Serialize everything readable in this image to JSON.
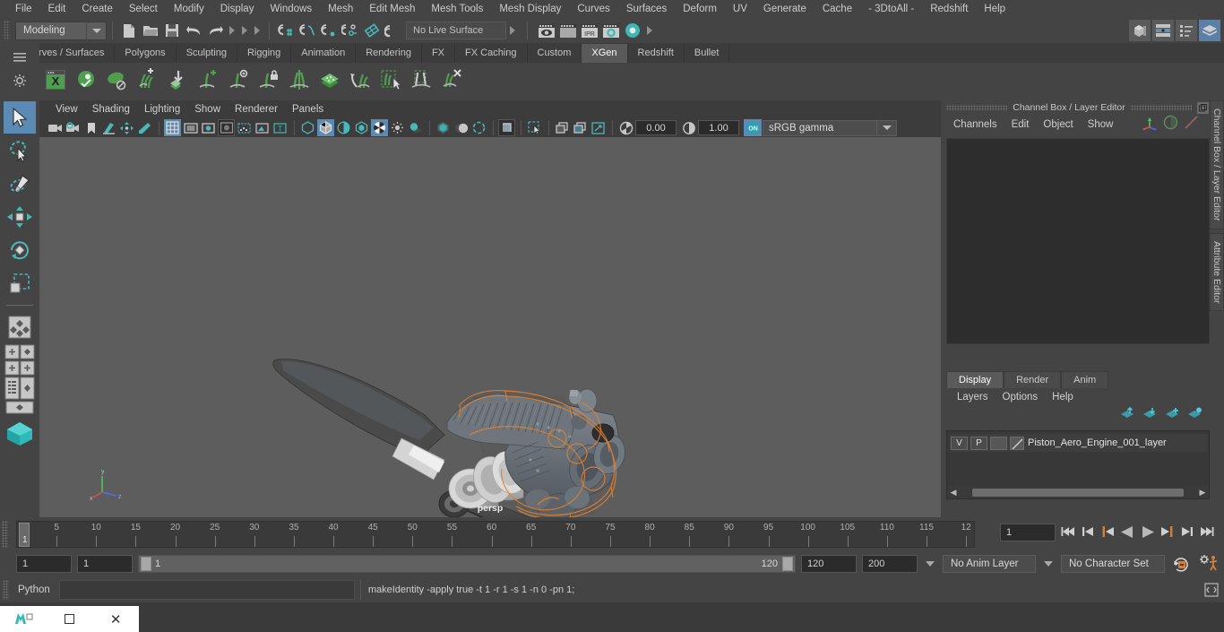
{
  "app": {
    "menubar": [
      "File",
      "Edit",
      "Create",
      "Select",
      "Modify",
      "Display",
      "Windows",
      "Mesh",
      "Edit Mesh",
      "Mesh Tools",
      "Mesh Display",
      "Curves",
      "Surfaces",
      "Deform",
      "UV",
      "Generate",
      "Cache",
      "- 3DtoAll -",
      "Redshift",
      "Help"
    ]
  },
  "status_line": {
    "menu_set": "Modeling",
    "live_surface": "No Live Surface",
    "icons": [
      "new-scene-icon",
      "open-scene-icon",
      "save-scene-icon",
      "undo-icon",
      "redo-icon",
      "select-by-hierarchy-icon",
      "select-by-object-icon",
      "select-by-component-icon",
      "snap-to-grid-icon",
      "snap-to-curve-icon",
      "snap-to-point-icon",
      "snap-to-projected-center-icon",
      "snap-to-view-plane-icon",
      "make-live-icon",
      "render-view-icon",
      "render-current-frame-icon",
      "ipr-render-icon",
      "render-settings-icon",
      "hypershade-icon"
    ],
    "right_icons": [
      "show-hide-modeling-toolkit-icon",
      "show-hide-attribute-editor-icon",
      "show-hide-tool-settings-icon",
      "show-hide-channel-box-icon"
    ]
  },
  "shelf": {
    "tabs": [
      "Curves / Surfaces",
      "Polygons",
      "Sculpting",
      "Rigging",
      "Animation",
      "Rendering",
      "FX",
      "FX Caching",
      "Custom",
      "XGen",
      "Redshift",
      "Bullet"
    ],
    "active_tab": "XGen",
    "icons": [
      "xgen-editor-icon",
      "xgen-preview-icon",
      "xgen-disable-preview-icon",
      "xgen-add-description-icon",
      "xgen-import-collection-icon",
      "xgen-add-guide-icon",
      "xgen-select-guide-icon",
      "xgen-lock-guide-icon",
      "xgen-mirror-guide-icon",
      "xgen-add-region-map-icon",
      "xgen-convert-to-interactive-icon",
      "xgen-select-primitives-icon",
      "xgen-clump-modifier-icon",
      "xgen-delete-guide-icon"
    ]
  },
  "toolbox": {
    "items": [
      "select-tool",
      "lasso-select-tool",
      "paint-select-tool",
      "move-tool",
      "rotate-tool",
      "scale-tool",
      "last-tool-used",
      "snap-layout-1",
      "snap-layout-2",
      "snap-layout-3",
      "snap-layout-4",
      "outliner-layout",
      "persp-layout",
      "single-perspective-view",
      "maya-logo"
    ],
    "selected": "select-tool"
  },
  "viewport": {
    "menus": [
      "View",
      "Shading",
      "Lighting",
      "Show",
      "Renderer",
      "Panels"
    ],
    "camera_label": "persp",
    "exposure": "0.00",
    "gamma": "1.00",
    "color_space": "sRGB gamma",
    "toolbar_icons": [
      "select-camera-icon",
      "camera-attributes-icon",
      "bookmark-icon",
      "image-plane-icon",
      "two-d-pan-zoom-icon",
      "grease-pencil-icon",
      "grid-toggle-icon",
      "film-gate-icon",
      "resolution-gate-icon",
      "gate-mask-icon",
      "film-origin-icon",
      "exposure-icon",
      "xray-icon",
      "wireframe-shaded-icon",
      "smooth-shaded-icon",
      "shaded-wireframe-icon",
      "textured-icon",
      "lighting-icon",
      "shadows-icon",
      "screen-space-ao-icon",
      "motion-blur-icon",
      "multisample-icon",
      "isolate-select-icon",
      "xray-joints-icon",
      "xray-active-components-icon",
      "exposure-gamma-icon",
      "view-transform-on-icon"
    ],
    "axis_gizmo": "axis-gizmo-xyz"
  },
  "channel_box": {
    "title": "Channel Box / Layer Editor",
    "menus": [
      "Channels",
      "Edit",
      "Object",
      "Show"
    ],
    "side_tabs": [
      "Channel Box / Layer Editor",
      "Attribute Editor"
    ],
    "header_icons": [
      "channel-box-icon",
      "attribute-editor-toggle-icon",
      "anim-layer-icon"
    ]
  },
  "layer_editor": {
    "tabs": [
      "Display",
      "Render",
      "Anim"
    ],
    "active_tab": "Display",
    "menus": [
      "Layers",
      "Options",
      "Help"
    ],
    "buttons": [
      "move-layer-up-icon",
      "move-layer-down-icon",
      "new-layer-icon",
      "new-layer-from-selected-icon"
    ],
    "layers": [
      {
        "visibility": "V",
        "playback": "P",
        "shading": "",
        "name": "Piston_Aero_Engine_001_layer"
      }
    ]
  },
  "timeline": {
    "tick_labels": [
      "5",
      "10",
      "15",
      "20",
      "25",
      "30",
      "35",
      "40",
      "45",
      "50",
      "55",
      "60",
      "65",
      "70",
      "75",
      "80",
      "85",
      "90",
      "95",
      "100",
      "105",
      "110",
      "115",
      "12"
    ],
    "current_frame_marker": "1",
    "current_frame_field": "1",
    "playback_icons": [
      "go-to-start-icon",
      "step-back-keyframe-icon",
      "step-back-frame-icon",
      "play-backwards-icon",
      "play-forwards-icon",
      "step-forward-frame-icon",
      "step-forward-keyframe-icon",
      "go-to-end-icon"
    ]
  },
  "range_slider": {
    "anim_start": "1",
    "range_start": "1",
    "bar_min": "1",
    "bar_max": "120",
    "range_end": "120",
    "anim_end": "200",
    "anim_layer": "No Anim Layer",
    "character_set": "No Character Set",
    "right_icons": [
      "auto-keyframe-icon",
      "animation-preferences-icon"
    ]
  },
  "command_line": {
    "label": "Python",
    "input_value": "",
    "result": "makeIdentity -apply true -t 1 -r 1 -s 1 -n 0 -pn 1;",
    "script_editor_icon": "script-editor-icon"
  },
  "taskbar": {
    "buttons": [
      "maya-app-icon",
      "restore-window-icon",
      "close-window-icon"
    ]
  },
  "colors": {
    "accent_blue": "#5b8bb5",
    "teal": "#4ab8b8",
    "xgen_green": "#5aa95a",
    "orange": "#d08040",
    "panel_bg": "#444444",
    "viewport_bg": "#5d5d5d"
  }
}
